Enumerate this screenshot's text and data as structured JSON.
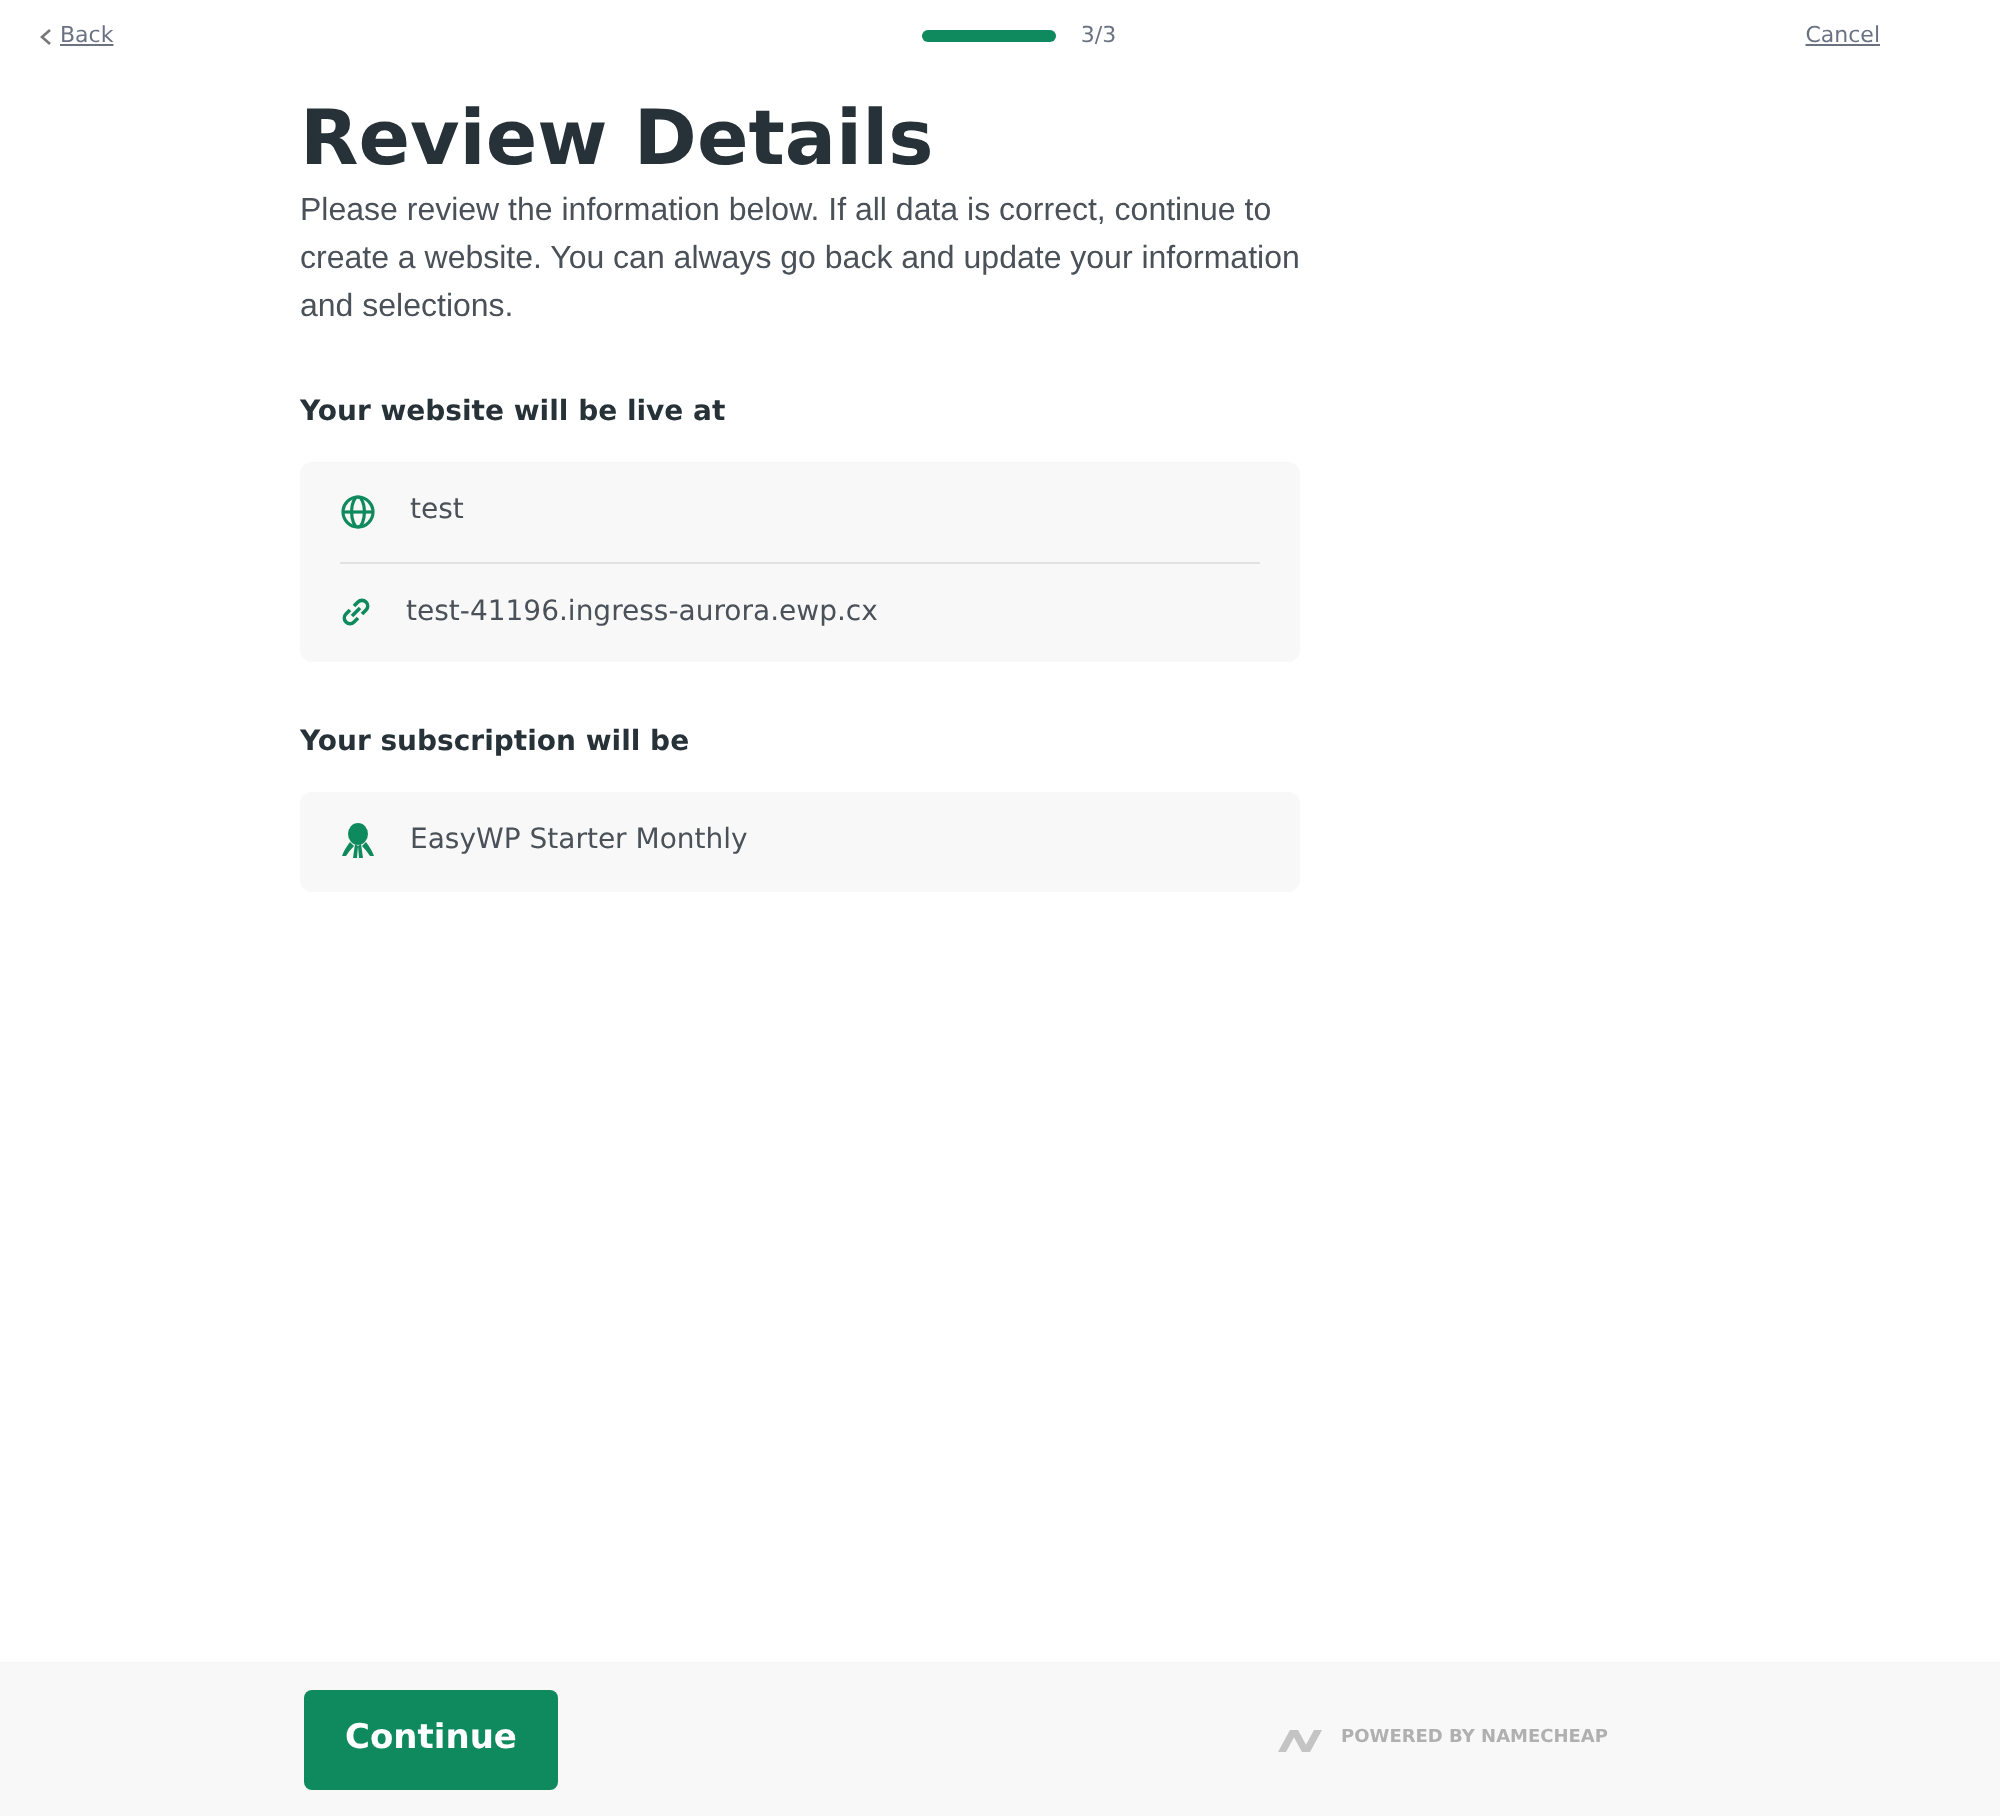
{
  "top_bar": {
    "back": "Back",
    "progress": {
      "level": 1,
      "step": "3/3"
    },
    "cancel": "Cancel"
  },
  "title": "Review Details",
  "intro": "Please review the information below. If all data is correct, continue to create a website. You can always go back and update your information and selections.",
  "sections": [
    {
      "heading": "Your website will be live at",
      "items": [
        {
          "kind": "domain",
          "text": "test"
        },
        {
          "kind": "url",
          "text": "test-41196.ingress-aurora.ewp.cx"
        }
      ]
    },
    {
      "heading": "Your subscription will be",
      "items": [
        {
          "kind": "plan",
          "text": "EasyWP Starter Monthly"
        }
      ]
    }
  ],
  "footer": {
    "button": "Continue",
    "powered_by": "POWERED BY NAMECHEAP"
  }
}
